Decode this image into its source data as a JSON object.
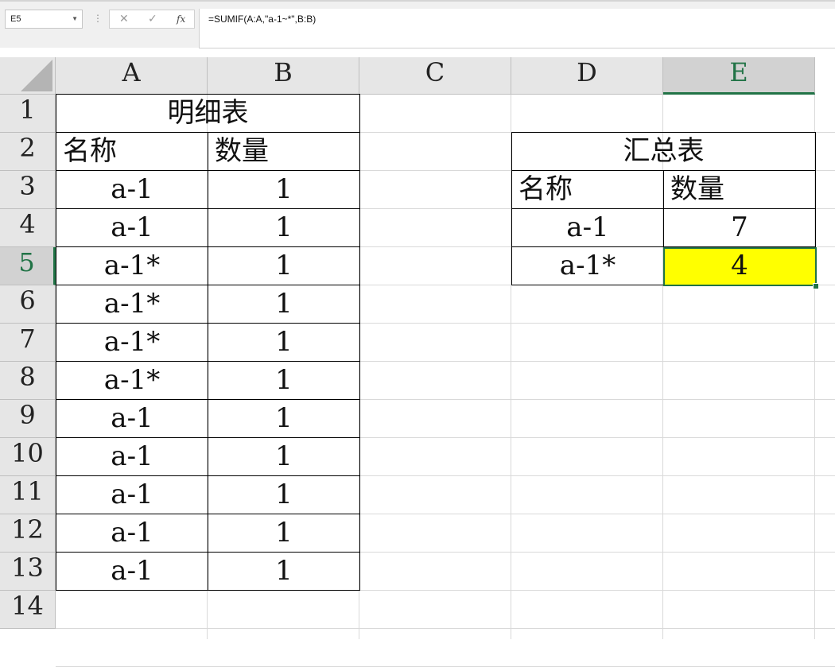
{
  "formula_bar": {
    "name_box": "E5",
    "cancel_icon": "✕",
    "enter_icon": "✓",
    "fx_label": "fx",
    "formula": "=SUMIF(A:A,\"a-1~*\",B:B)"
  },
  "columns": [
    "A",
    "B",
    "C",
    "D",
    "E"
  ],
  "rows": [
    "1",
    "2",
    "3",
    "4",
    "5",
    "6",
    "7",
    "8",
    "9",
    "10",
    "11",
    "12",
    "13",
    "14"
  ],
  "selected_cell": "E5",
  "detail_table": {
    "title": "明细表",
    "headers": [
      "名称",
      "数量"
    ],
    "rows": [
      [
        "a-1",
        "1"
      ],
      [
        "a-1",
        "1"
      ],
      [
        "a-1*",
        "1"
      ],
      [
        "a-1*",
        "1"
      ],
      [
        "a-1*",
        "1"
      ],
      [
        "a-1*",
        "1"
      ],
      [
        "a-1",
        "1"
      ],
      [
        "a-1",
        "1"
      ],
      [
        "a-1",
        "1"
      ],
      [
        "a-1",
        "1"
      ],
      [
        "a-1",
        "1"
      ]
    ]
  },
  "summary_table": {
    "title": "汇总表",
    "headers": [
      "名称",
      "数量"
    ],
    "rows": [
      [
        "a-1",
        "7"
      ],
      [
        "a-1*",
        "4"
      ]
    ]
  },
  "colors": {
    "selection": "#217346",
    "highlight": "#ffff00"
  }
}
